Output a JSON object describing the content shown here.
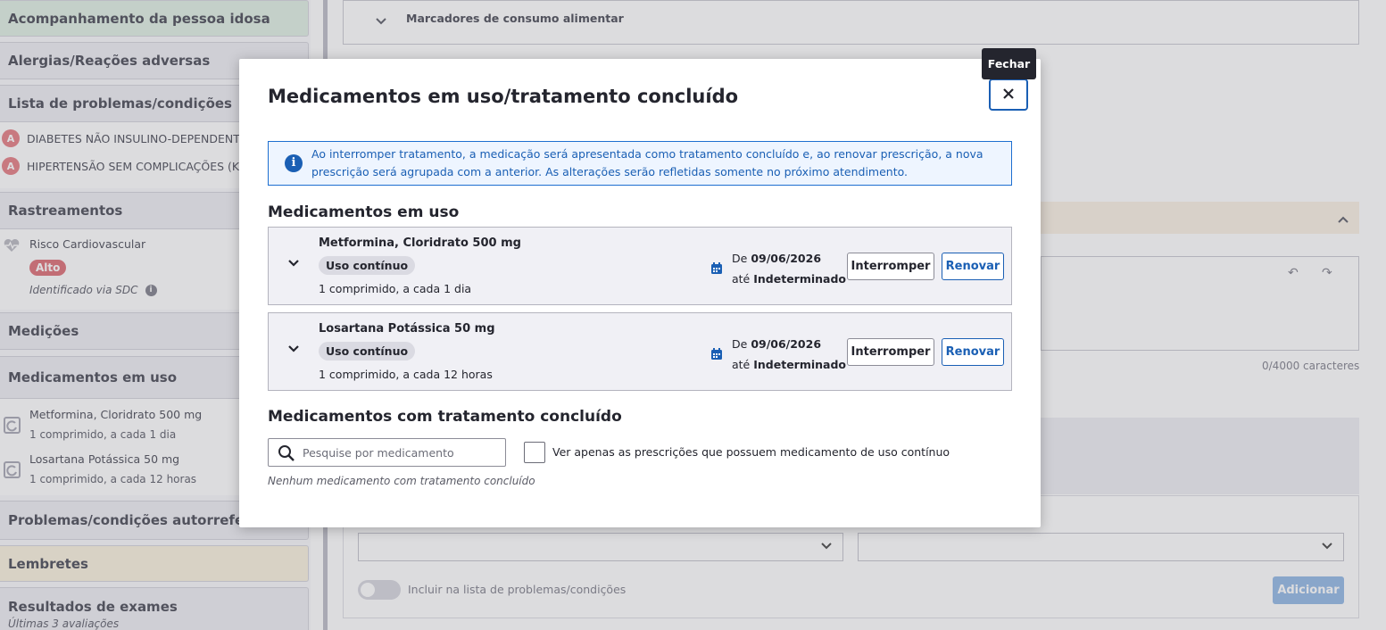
{
  "sidebar": {
    "acompanhamento": "Acompanhamento da pessoa idosa",
    "alergias": "Alergias/Reações adversas",
    "problemas_title": "Lista de problemas/condições",
    "problemas": [
      {
        "badge": "A",
        "label": "DIABETES NÃO INSULINO-DEPENDENTE"
      },
      {
        "badge": "A",
        "label": "HIPERTENSÃO SEM COMPLICAÇÕES (K"
      }
    ],
    "rastreamentos_title": "Rastreamentos",
    "risco_label": "Risco Cardiovascular",
    "risco_badge": "Alto",
    "risco_note": "Identificado via SDC",
    "medicoes": "Medições",
    "medicamentos_title": "Medicamentos em uso",
    "medicamentos": [
      {
        "name": "Metformina, Cloridrato 500 mg",
        "dose": "1 comprimido, a cada 1 dia"
      },
      {
        "name": "Losartana Potássica 50 mg",
        "dose": "1 comprimido, a cada 12 horas"
      }
    ],
    "autorreferidos": "Problemas/condições autorreferid",
    "lembretes": "Lembretes",
    "resultados_title": "Resultados de exames",
    "resultados_sub": "Últimas 3 avaliações"
  },
  "main": {
    "marcadores": "Marcadores de consumo alimentar",
    "char_count": "0/4000 caracteres",
    "toggle_label": "Incluir na lista de problemas/condições",
    "adicionar": "Adicionar"
  },
  "modal": {
    "title": "Medicamentos em uso/tratamento concluído",
    "close_tooltip": "Fechar",
    "info_text": "Ao interromper tratamento, a medicação será apresentada como tratamento concluído e, ao renovar prescrição, a nova prescrição será agrupada com a anterior. As alterações serão refletidas somente no próximo atendimento.",
    "em_uso_title": "Medicamentos em uso",
    "medications": [
      {
        "name": "Metformina, Cloridrato 500 mg",
        "chip": "Uso contínuo",
        "dose": "1 comprimido, a cada 1 dia",
        "from_prefix": "De",
        "from_date": "09/06/2026",
        "until_prefix": "até",
        "until_value": "Indeterminado",
        "interromper": "Interromper",
        "renovar": "Renovar"
      },
      {
        "name": "Losartana Potássica 50 mg",
        "chip": "Uso contínuo",
        "dose": "1 comprimido, a cada 12 horas",
        "from_prefix": "De",
        "from_date": "09/06/2026",
        "until_prefix": "até",
        "until_value": "Indeterminado",
        "interromper": "Interromper",
        "renovar": "Renovar"
      }
    ],
    "concluido_title": "Medicamentos com tratamento concluído",
    "search_placeholder": "Pesquise por medicamento",
    "checkbox_label": "Ver apenas as prescrições que possuem medicamento de uso contínuo",
    "empty_text": "Nenhum medicamento com tratamento concluído"
  },
  "colors": {
    "primary": "#1a5fb4",
    "alert_bg": "#eef5ff",
    "badge_red": "#e07b82",
    "chip_bg": "#dadae2"
  }
}
